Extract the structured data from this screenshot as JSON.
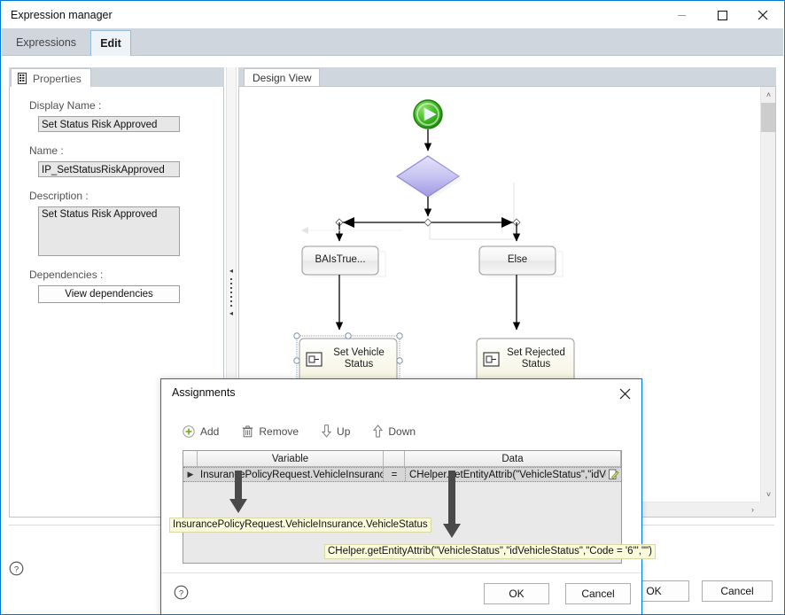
{
  "window": {
    "title": "Expression manager",
    "minimize_icon": "minimize-icon",
    "maximize_icon": "maximize-icon",
    "close_icon": "close-icon"
  },
  "tabs": [
    {
      "label": "Expressions",
      "active": false
    },
    {
      "label": "Edit",
      "active": true
    }
  ],
  "properties": {
    "tab_label": "Properties",
    "tab_icon": "properties-grid-icon",
    "display_name_label": "Display Name :",
    "display_name_value": "Set Status Risk Approved",
    "name_label": "Name :",
    "name_value": "IP_SetStatusRiskApproved",
    "description_label": "Description :",
    "description_value": "Set Status Risk Approved",
    "dependencies_label": "Dependencies :",
    "view_dependencies_label": "View dependencies"
  },
  "design": {
    "tab_label": "Design View",
    "nodes": {
      "start": {
        "name": "start-node",
        "icon": "play-icon"
      },
      "decision": {
        "name": "decision-diamond",
        "label": ""
      },
      "branch_true": {
        "label": "BAIsTrue..."
      },
      "branch_else": {
        "label": "Else"
      },
      "activity_left": {
        "label": "Set Vehicle Status",
        "line1": "Set Vehicle",
        "line2": "Status",
        "selected": true
      },
      "activity_right": {
        "label": "Set Rejected Status",
        "line1": "Set Rejected",
        "line2": "Status",
        "selected": false
      }
    },
    "scroll": {
      "v_up": "˄",
      "v_down": "˅",
      "h_left": "‹",
      "h_right": "›"
    }
  },
  "footer": {
    "help_icon": "help-icon",
    "ok_label": "OK",
    "cancel_label": "Cancel"
  },
  "assignments_dialog": {
    "title": "Assignments",
    "close_icon": "close-icon",
    "toolbar": [
      {
        "label": "Add",
        "icon": "add-circle-icon"
      },
      {
        "label": "Remove",
        "icon": "trash-icon"
      },
      {
        "label": "Up",
        "icon": "arrow-down-outline-icon"
      },
      {
        "label": "Down",
        "icon": "arrow-up-outline-icon"
      }
    ],
    "grid": {
      "columns": [
        "",
        "Variable",
        "",
        "Data",
        ""
      ],
      "rows": [
        {
          "indicator": "▶",
          "variable": "InsurancePolicyRequest.VehicleInsuranc",
          "operator": "=",
          "data": "CHelper.getEntityAttrib(\"VehicleStatus\",\"idVe",
          "edit_icon": "edit-pencil-icon"
        }
      ]
    },
    "tooltips": [
      {
        "text": "InsurancePolicyRequest.VehicleInsurance.VehicleStatus"
      },
      {
        "text": "CHelper.getEntityAttrib(\"VehicleStatus\",\"idVehicleStatus\",\"Code = '6'\",\"\")"
      }
    ],
    "help_icon": "help-icon",
    "ok_label": "OK",
    "cancel_label": "Cancel"
  },
  "colors": {
    "accent": "#0078d7",
    "tabstrip": "#d0d6dd",
    "active_tab": "#eef3f7",
    "start_green": "#2faa1e",
    "diamond_purple": "#b9b6ee",
    "activity_fill": "#fbfbe8",
    "tooltip_bg": "#fbfbdc",
    "grid_row": "#d6d6d6"
  }
}
